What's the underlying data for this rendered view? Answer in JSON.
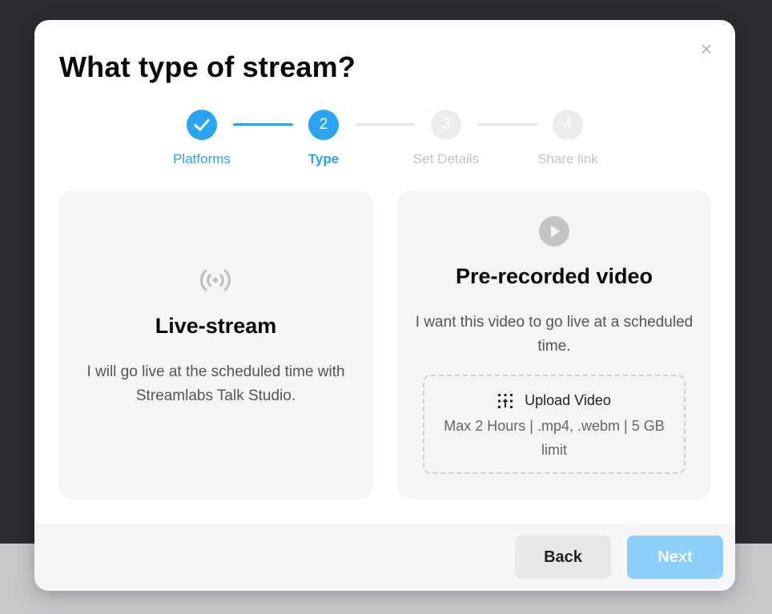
{
  "dialog": {
    "title": "What type of stream?",
    "close_symbol": "×"
  },
  "stepper": {
    "steps": [
      {
        "number": "",
        "label": "Platforms",
        "state": "done"
      },
      {
        "number": "2",
        "label": "Type",
        "state": "current"
      },
      {
        "number": "3",
        "label": "Set Details",
        "state": "todo"
      },
      {
        "number": "4",
        "label": "Share link",
        "state": "todo"
      }
    ]
  },
  "options": {
    "live": {
      "icon": "broadcast-icon",
      "title": "Live-stream",
      "description": "I will go live at the scheduled time with Streamlabs Talk Studio."
    },
    "prerecorded": {
      "icon": "play-icon",
      "title": "Pre-recorded video",
      "description": "I want this video to go live at a scheduled time.",
      "upload": {
        "icon": "upload-icon",
        "label": "Upload Video",
        "hint": "Max 2 Hours | .mp4, .webm | 5 GB limit"
      }
    }
  },
  "footer": {
    "back_label": "Back",
    "next_label": "Next"
  },
  "colors": {
    "accent": "#2aa4f4",
    "next_disabled": "#8ccff8",
    "card_bg": "#f5f5f5"
  }
}
